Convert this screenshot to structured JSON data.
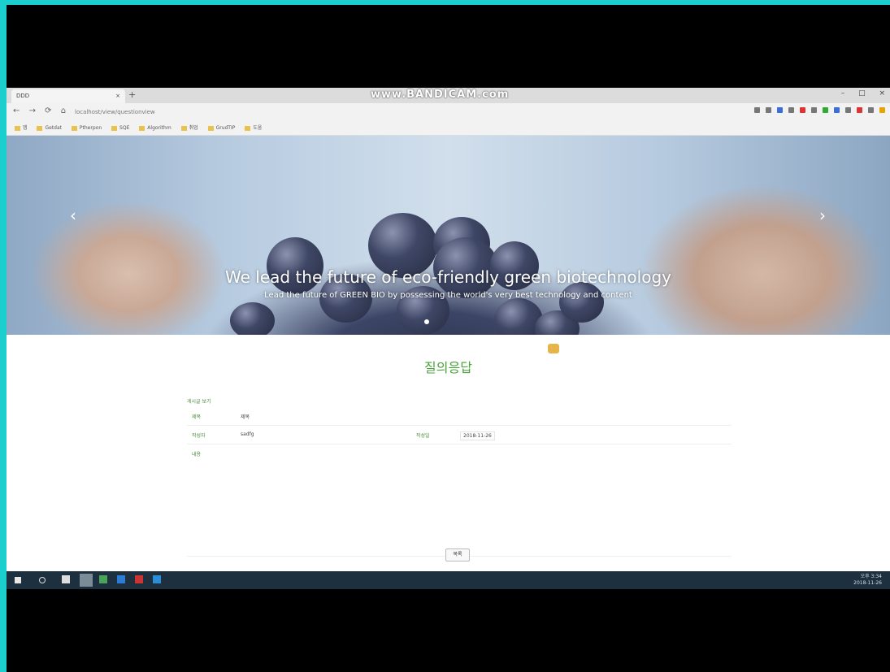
{
  "browser": {
    "tab_title": "DDD",
    "tab_close": "×",
    "new_tab": "+",
    "watermark": "www.BANDICAM.com",
    "window_controls": [
      "–",
      "□",
      "×"
    ],
    "nav": [
      "←",
      "→",
      "⟳",
      "⌂"
    ],
    "url": "localhost/view/questionview",
    "bookmarks": [
      "앱",
      "Getdat",
      "Ptherpon",
      "SQE",
      "Algorithm",
      "취업",
      "GrudTIP",
      "도움"
    ]
  },
  "hero": {
    "prev_arrow": "‹",
    "next_arrow": "›",
    "headline": "We lead the future of eco-friendly green biotechnology",
    "subline": "Lead the future of GREEN BIO by possessing the world's very best technology and content"
  },
  "page": {
    "title": "질의응답",
    "form_caption": "게시글 보기",
    "fields": {
      "subject_label": "제목",
      "subject_value": "제목",
      "author_label": "작성자",
      "author_value": "sadfg",
      "date_label": "작성일",
      "date_value": "2018-11-26",
      "content_label": "내용"
    },
    "list_button": "목록"
  },
  "taskbar": {
    "time": "오후 3:34",
    "date": "2018-11-26"
  },
  "colors": {
    "accent_green": "#4aa33b",
    "frame": "#1ccfcf",
    "taskbar": "#1c3040"
  }
}
